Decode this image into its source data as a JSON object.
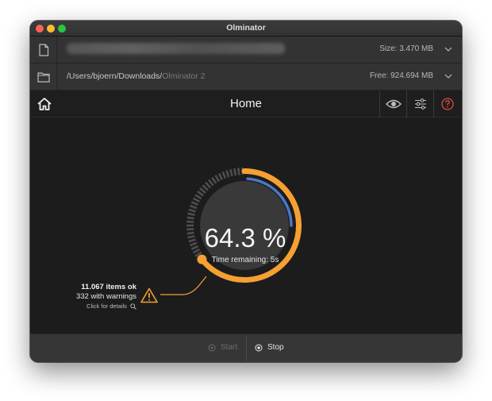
{
  "window": {
    "title": "Olminator"
  },
  "source_row": {
    "icon": "file-icon",
    "size_label": "Size: 3.470 MB"
  },
  "dest_row": {
    "icon": "folder-icon",
    "path_main": "/Users/bjoern/Downloads/",
    "path_faded": "Olminator 2",
    "free_label": "Free: 924.694 MB"
  },
  "toolbar": {
    "title": "Home",
    "icons": [
      "home-icon",
      "eye-icon",
      "sliders-icon",
      "help-icon"
    ]
  },
  "progress": {
    "percent_text": "64.3 %",
    "fraction": 0.643,
    "inner_fraction": 0.25,
    "time_remaining": "Time remaining: 5s"
  },
  "stats": {
    "ok": "11.067 items ok",
    "warnings": "332 with warnings",
    "details": "Click for details"
  },
  "bottom": {
    "start_label": "Start",
    "stop_label": "Stop"
  },
  "colors": {
    "accent": "#f5a033",
    "inner_arc": "#4a78c8",
    "help": "#e04a3f",
    "track": "#4e4e4e"
  }
}
